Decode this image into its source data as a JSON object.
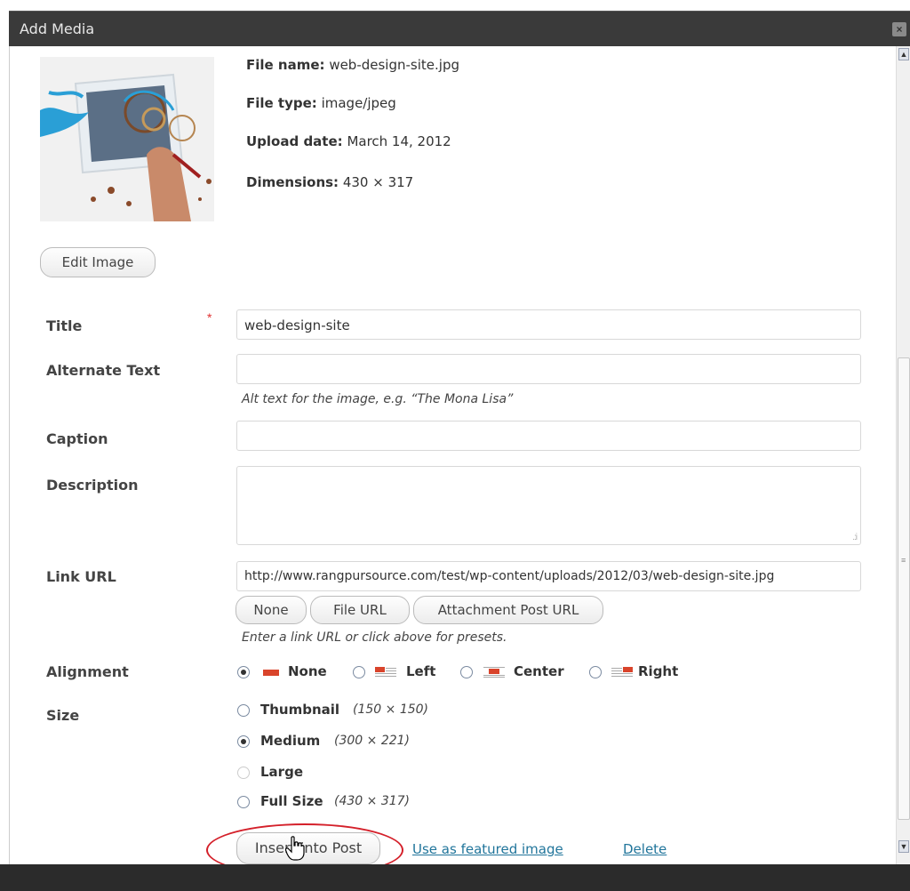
{
  "dialog": {
    "title": "Add Media"
  },
  "meta": {
    "file_name_label": "File name:",
    "file_name": "web-design-site.jpg",
    "file_type_label": "File type:",
    "file_type": "image/jpeg",
    "upload_date_label": "Upload date:",
    "upload_date": "March 14, 2012",
    "dimensions_label": "Dimensions:",
    "dimensions": "430 × 317"
  },
  "buttons": {
    "edit_image": "Edit Image",
    "none": "None",
    "file_url": "File URL",
    "attachment_post_url": "Attachment Post URL",
    "insert_into_post": "Insert into Post"
  },
  "fields": {
    "title_label": "Title",
    "title_required": "*",
    "title_value": "web-design-site",
    "alt_label": "Alternate Text",
    "alt_value": "",
    "alt_help": "Alt text for the image, e.g. “The Mona Lisa”",
    "caption_label": "Caption",
    "caption_value": "",
    "description_label": "Description",
    "description_value": "",
    "link_url_label": "Link URL",
    "link_url_value": "http://www.rangpursource.com/test/wp-content/uploads/2012/03/web-design-site.jpg",
    "link_help": "Enter a link URL or click above for presets."
  },
  "alignment": {
    "label": "Alignment",
    "options": [
      "None",
      "Left",
      "Center",
      "Right"
    ],
    "selected": "None"
  },
  "size": {
    "label": "Size",
    "options": [
      {
        "name": "Thumbnail",
        "dims": "(150 × 150)"
      },
      {
        "name": "Medium",
        "dims": "(300 × 221)"
      },
      {
        "name": "Large",
        "dims": ""
      },
      {
        "name": "Full Size",
        "dims": "(430 × 317)"
      }
    ],
    "selected": "Medium",
    "disabled": "Large"
  },
  "links": {
    "featured": "Use as featured image",
    "delete": "Delete"
  },
  "colors": {
    "titlebar": "#3a3a3a",
    "link": "#21759b",
    "highlight": "#d4202a",
    "align_icon": "#d9442b"
  }
}
